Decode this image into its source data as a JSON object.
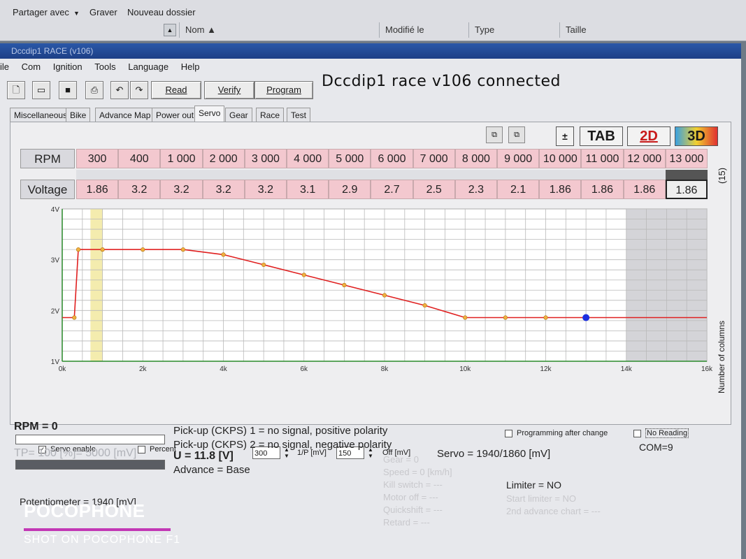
{
  "explorer": {
    "share_label": "Partager avec",
    "burn_label": "Graver",
    "new_folder_label": "Nouveau dossier",
    "columns": [
      "Nom",
      "Modifié le",
      "Type",
      "Taille"
    ]
  },
  "app": {
    "title": "Dccdip1 RACE (v106)",
    "menu": [
      "ile",
      "Com",
      "Ignition",
      "Tools",
      "Language",
      "Help"
    ],
    "buttons": {
      "read": "Read",
      "verify": "Verify",
      "program": "Program"
    },
    "connected": "Dccdip1 race v106 connected",
    "tabs": [
      "Miscellaneous",
      "Bike",
      "Advance Map",
      "Power out",
      "Servo",
      "Gear",
      "Race",
      "Test"
    ],
    "active_tab": "Servo",
    "view_buttons": {
      "tab": "TAB",
      "two_d": "2D",
      "three_d": "3D"
    },
    "columns_label": "Number of columns",
    "columns_value": "(15)"
  },
  "table": {
    "rpm_label": "RPM",
    "voltage_label": "Voltage",
    "rpm": [
      "300",
      "400",
      "1 000",
      "2 000",
      "3 000",
      "4 000",
      "5 000",
      "6 000",
      "7 000",
      "8 000",
      "9 000",
      "10 000",
      "11 000",
      "12 000",
      "13 000"
    ],
    "voltage": [
      "1.86",
      "3.2",
      "3.2",
      "3.2",
      "3.2",
      "3.1",
      "2.9",
      "2.7",
      "2.5",
      "2.3",
      "2.1",
      "1.86",
      "1.86",
      "1.86",
      "1.86"
    ]
  },
  "chart_data": {
    "type": "line",
    "x": [
      0,
      300,
      400,
      1000,
      2000,
      3000,
      4000,
      5000,
      6000,
      7000,
      8000,
      9000,
      10000,
      11000,
      12000,
      13000,
      16000
    ],
    "y": [
      1.86,
      1.86,
      3.2,
      3.2,
      3.2,
      3.2,
      3.1,
      2.9,
      2.7,
      2.5,
      2.3,
      2.1,
      1.86,
      1.86,
      1.86,
      1.86,
      1.86
    ],
    "points_x": [
      300,
      400,
      1000,
      2000,
      3000,
      4000,
      5000,
      6000,
      7000,
      8000,
      9000,
      10000,
      11000,
      12000,
      13000
    ],
    "selected_x": 13000,
    "xlim": [
      0,
      16000
    ],
    "ylim": [
      1,
      4
    ],
    "x_ticks": [
      "0k",
      "2k",
      "4k",
      "6k",
      "8k",
      "10k",
      "12k",
      "14k",
      "16k"
    ],
    "y_ticks": [
      "1V",
      "2V",
      "3V",
      "4V"
    ],
    "line_color": "#e02020",
    "point_color": "#f0b040",
    "selected_color": "#1c2fe0",
    "highlight_x": [
      700,
      1000
    ],
    "shaded_x": [
      14000,
      16000
    ],
    "grid": true
  },
  "controls": {
    "servo_enable": "Servo enable",
    "percent": "Percent",
    "ip_value": "300",
    "ip_label": "1/P [mV]",
    "off_value": "150",
    "off_label": "Off [mV]",
    "servo_readout": "Servo = 1940/1860 [mV]"
  },
  "status": {
    "rpm": "RPM = 0",
    "tp": "TP= 100 [%]= 5000 [mV]",
    "pickup1": "Pick-up (CKPS) 1 = no signal, positive polarity",
    "pickup2": "Pick-up (CKPS) 2 = no signal, negative polarity",
    "voltage": "U = 11.8 [V]",
    "advance": "Advance = Base",
    "gear": "Gear = 0",
    "speed": "Speed = 0 [km/h]",
    "kill": "Kill switch = ---",
    "motor_off": "Motor off = ---",
    "quickshift": "Quickshift = ---",
    "retard": "Retard = ---",
    "prog_after_change": "Programming after change",
    "no_reading": "No Reading",
    "com": "COM=9",
    "limiter": "Limiter = NO",
    "start_limiter": "Start limiter = NO",
    "adv_chart2": "2nd advance chart = ---",
    "potentiometer": "Potentiometer = 1940 [mV]"
  },
  "watermark": {
    "brand": "POCOPHONE",
    "shot": "SHOT ON POCOPHONE F1"
  }
}
